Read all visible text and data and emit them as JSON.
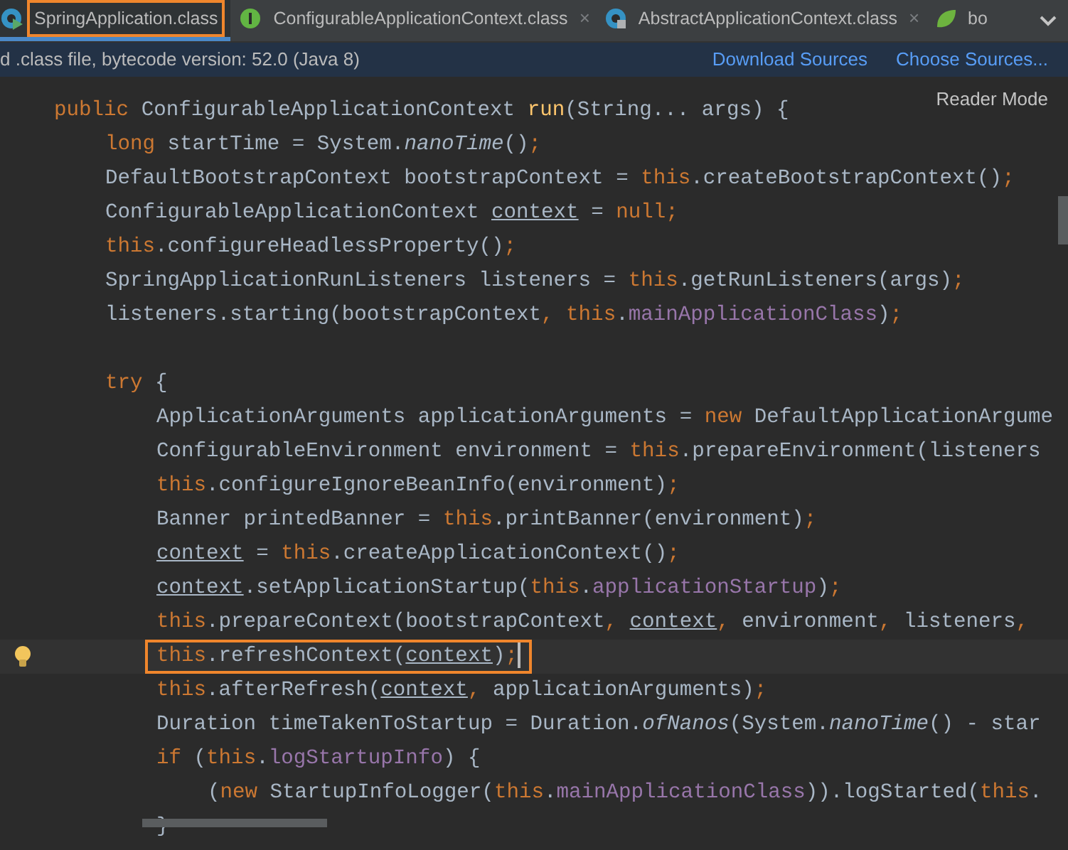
{
  "tabs": [
    {
      "label": "SpringApplication.class",
      "selected": true,
      "annotated": true
    },
    {
      "label": "ConfigurableApplicationContext.class",
      "selected": false,
      "annotated": false,
      "close": "×"
    },
    {
      "label": "AbstractApplicationContext.class",
      "selected": false,
      "annotated": false,
      "close": "×"
    },
    {
      "label": "bo",
      "selected": false,
      "annotated": false
    }
  ],
  "banner": {
    "message": "d .class file, bytecode version: 52.0 (Java 8)",
    "links": [
      "Download Sources",
      "Choose Sources..."
    ]
  },
  "reader_mode": "Reader Mode",
  "lines": [
    {
      "current": false,
      "annotated": false,
      "tokens": [
        {
          "kind": "keyword",
          "text": "public "
        },
        {
          "kind": "plain",
          "text": "ConfigurableApplicationContext "
        },
        {
          "kind": "decl",
          "text": "run"
        },
        {
          "kind": "plain",
          "text": "(String... args) {"
        }
      ],
      "children": [
        {
          "current": false,
          "annotated": false,
          "tokens": [
            {
              "kind": "keyword",
              "text": "long"
            },
            {
              "kind": "plain",
              "text": " startTime = System."
            },
            {
              "kind": "italic",
              "text": "nanoTime"
            },
            {
              "kind": "plain",
              "text": "()"
            },
            {
              "kind": "keyword",
              "text": ";"
            }
          ]
        },
        {
          "current": false,
          "annotated": false,
          "tokens": [
            {
              "kind": "plain",
              "text": "DefaultBootstrapContext bootstrapContext = "
            },
            {
              "kind": "keyword",
              "text": "this"
            },
            {
              "kind": "plain",
              "text": ".createBootstrapContext()"
            },
            {
              "kind": "keyword",
              "text": ";"
            }
          ]
        },
        {
          "current": false,
          "annotated": false,
          "tokens": [
            {
              "kind": "plain",
              "text": "ConfigurableApplicationContext "
            },
            {
              "kind": "underlined",
              "text": "context"
            },
            {
              "kind": "plain",
              "text": " = "
            },
            {
              "kind": "keyword",
              "text": "null;"
            }
          ]
        },
        {
          "current": false,
          "annotated": false,
          "tokens": [
            {
              "kind": "keyword",
              "text": "this"
            },
            {
              "kind": "plain",
              "text": ".configureHeadlessProperty()"
            },
            {
              "kind": "keyword",
              "text": ";"
            }
          ]
        },
        {
          "current": false,
          "annotated": false,
          "tokens": [
            {
              "kind": "plain",
              "text": "SpringApplicationRunListeners listeners = "
            },
            {
              "kind": "keyword",
              "text": "this"
            },
            {
              "kind": "plain",
              "text": ".getRunListeners(args)"
            },
            {
              "kind": "keyword",
              "text": ";"
            }
          ]
        },
        {
          "current": false,
          "annotated": false,
          "tokens": [
            {
              "kind": "plain",
              "text": "listeners.starting(bootstrapContext"
            },
            {
              "kind": "keyword",
              "text": ", this"
            },
            {
              "kind": "plain",
              "text": "."
            },
            {
              "kind": "field",
              "text": "mainApplicationClass"
            },
            {
              "kind": "plain",
              "text": ")"
            },
            {
              "kind": "keyword",
              "text": ";"
            }
          ]
        },
        {
          "current": false,
          "annotated": false
        },
        {
          "current": false,
          "annotated": false,
          "tokens": [
            {
              "kind": "keyword",
              "text": "try "
            },
            {
              "kind": "plain",
              "text": "{"
            }
          ],
          "children": [
            {
              "current": false,
              "annotated": false,
              "tokens": [
                {
                  "kind": "plain",
                  "text": "ApplicationArguments applicationArguments = "
                },
                {
                  "kind": "keyword",
                  "text": "new "
                },
                {
                  "kind": "plain",
                  "text": "DefaultApplicationArgume"
                }
              ]
            },
            {
              "current": false,
              "annotated": false,
              "tokens": [
                {
                  "kind": "plain",
                  "text": "ConfigurableEnvironment environment = "
                },
                {
                  "kind": "keyword",
                  "text": "this"
                },
                {
                  "kind": "plain",
                  "text": ".prepareEnvironment(listeners"
                }
              ]
            },
            {
              "current": false,
              "annotated": false,
              "tokens": [
                {
                  "kind": "keyword",
                  "text": "this"
                },
                {
                  "kind": "plain",
                  "text": ".configureIgnoreBeanInfo(environment)"
                },
                {
                  "kind": "keyword",
                  "text": ";"
                }
              ]
            },
            {
              "current": false,
              "annotated": false,
              "tokens": [
                {
                  "kind": "plain",
                  "text": "Banner printedBanner = "
                },
                {
                  "kind": "keyword",
                  "text": "this"
                },
                {
                  "kind": "plain",
                  "text": ".printBanner(environment)"
                },
                {
                  "kind": "keyword",
                  "text": ";"
                }
              ]
            },
            {
              "current": false,
              "annotated": false,
              "tokens": [
                {
                  "kind": "underlined",
                  "text": "context"
                },
                {
                  "kind": "plain",
                  "text": " = "
                },
                {
                  "kind": "keyword",
                  "text": "this"
                },
                {
                  "kind": "plain",
                  "text": ".createApplicationContext()"
                },
                {
                  "kind": "keyword",
                  "text": ";"
                }
              ]
            },
            {
              "current": false,
              "annotated": false,
              "tokens": [
                {
                  "kind": "underlined",
                  "text": "context"
                },
                {
                  "kind": "plain",
                  "text": ".setApplicationStartup("
                },
                {
                  "kind": "keyword",
                  "text": "this"
                },
                {
                  "kind": "plain",
                  "text": "."
                },
                {
                  "kind": "field",
                  "text": "applicationStartup"
                },
                {
                  "kind": "plain",
                  "text": ")"
                },
                {
                  "kind": "keyword",
                  "text": ";"
                }
              ]
            },
            {
              "current": false,
              "annotated": false,
              "tokens": [
                {
                  "kind": "keyword",
                  "text": "this"
                },
                {
                  "kind": "plain",
                  "text": ".prepareContext(bootstrapContext"
                },
                {
                  "kind": "keyword",
                  "text": ", "
                },
                {
                  "kind": "underlined",
                  "text": "context"
                },
                {
                  "kind": "keyword",
                  "text": ", "
                },
                {
                  "kind": "plain",
                  "text": "environment"
                },
                {
                  "kind": "keyword",
                  "text": ", "
                },
                {
                  "kind": "plain",
                  "text": "listeners"
                },
                {
                  "kind": "keyword",
                  "text": ","
                }
              ]
            },
            {
              "current": true,
              "annotated": true,
              "tokens": [
                {
                  "kind": "keyword",
                  "text": "this"
                },
                {
                  "kind": "plain",
                  "text": ".refreshContext("
                },
                {
                  "kind": "underlined",
                  "text": "context"
                },
                {
                  "kind": "plain",
                  "text": ")"
                },
                {
                  "kind": "keyword",
                  "text": ";"
                }
              ]
            },
            {
              "current": false,
              "annotated": false,
              "tokens": [
                {
                  "kind": "keyword",
                  "text": "this"
                },
                {
                  "kind": "plain",
                  "text": ".afterRefresh("
                },
                {
                  "kind": "underlined",
                  "text": "context"
                },
                {
                  "kind": "keyword",
                  "text": ", "
                },
                {
                  "kind": "plain",
                  "text": "applicationArguments)"
                },
                {
                  "kind": "keyword",
                  "text": ";"
                }
              ]
            },
            {
              "current": false,
              "annotated": false,
              "tokens": [
                {
                  "kind": "plain",
                  "text": "Duration timeTakenToStartup = Duration."
                },
                {
                  "kind": "italic",
                  "text": "ofNanos"
                },
                {
                  "kind": "plain",
                  "text": "(System."
                },
                {
                  "kind": "italic",
                  "text": "nanoTime"
                },
                {
                  "kind": "plain",
                  "text": "() - star"
                }
              ]
            },
            {
              "current": false,
              "annotated": false,
              "tokens": [
                {
                  "kind": "keyword",
                  "text": "if "
                },
                {
                  "kind": "plain",
                  "text": "("
                },
                {
                  "kind": "keyword",
                  "text": "this"
                },
                {
                  "kind": "plain",
                  "text": "."
                },
                {
                  "kind": "field",
                  "text": "logStartupInfo"
                },
                {
                  "kind": "plain",
                  "text": ") {"
                }
              ],
              "children": [
                {
                  "current": false,
                  "annotated": false,
                  "tokens": [
                    {
                      "kind": "plain",
                      "text": "("
                    },
                    {
                      "kind": "keyword",
                      "text": "new "
                    },
                    {
                      "kind": "plain",
                      "text": "StartupInfoLogger("
                    },
                    {
                      "kind": "keyword",
                      "text": "this"
                    },
                    {
                      "kind": "plain",
                      "text": "."
                    },
                    {
                      "kind": "field",
                      "text": "mainApplicationClass"
                    },
                    {
                      "kind": "plain",
                      "text": ")).logStarted("
                    },
                    {
                      "kind": "keyword",
                      "text": "this"
                    },
                    {
                      "kind": "plain",
                      "text": "."
                    }
                  ]
                }
              ]
            },
            {
              "current": false,
              "annotated": false,
              "tokens": [
                {
                  "kind": "plain",
                  "text": "}"
                }
              ]
            }
          ]
        }
      ]
    }
  ]
}
